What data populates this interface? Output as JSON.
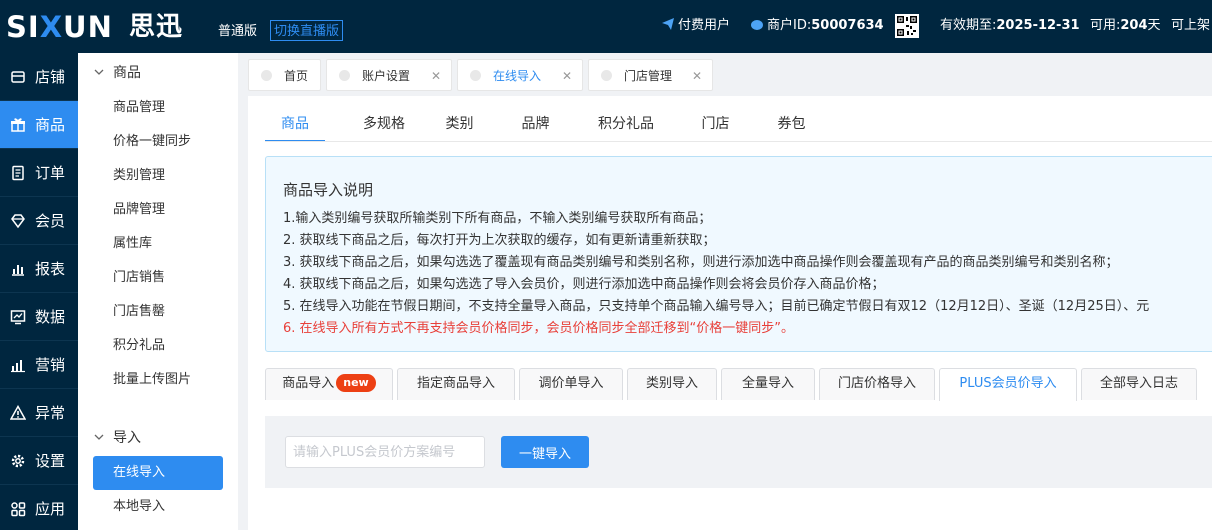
{
  "header": {
    "logo_text_a": "SI",
    "logo_text_x": "X",
    "logo_text_b": "UN",
    "logo_cn": "思迅",
    "edition": "普通版",
    "switch_label": "切换直播版",
    "paid_user": "付费用户",
    "merchant_label": "商户ID:",
    "merchant_id": "50007634",
    "valid_label": "有效期至:",
    "valid_date": "2025-12-31",
    "avail_label": "可用:",
    "avail_days": "204",
    "avail_unit": "天",
    "shelf": "可上架"
  },
  "leftnav": {
    "items": [
      {
        "label": "店铺",
        "icon": "store-icon"
      },
      {
        "label": "商品",
        "icon": "gift-icon"
      },
      {
        "label": "订单",
        "icon": "order-icon"
      },
      {
        "label": "会员",
        "icon": "diamond-icon"
      },
      {
        "label": "报表",
        "icon": "report-icon"
      },
      {
        "label": "数据",
        "icon": "data-icon"
      },
      {
        "label": "营销",
        "icon": "marketing-icon"
      },
      {
        "label": "异常",
        "icon": "warning-icon"
      },
      {
        "label": "设置",
        "icon": "gear-icon"
      },
      {
        "label": "应用",
        "icon": "apps-icon"
      }
    ],
    "active_index": 1
  },
  "submenu": {
    "group1": "商品",
    "items1": [
      "商品管理",
      "价格一键同步",
      "类别管理",
      "品牌管理",
      "属性库",
      "门店销售",
      "门店售罄",
      "积分礼品",
      "批量上传图片"
    ],
    "group2": "导入",
    "items2": [
      "在线导入",
      "本地导入"
    ],
    "active": "在线导入"
  },
  "pagetabs": [
    {
      "label": "首页",
      "closable": false
    },
    {
      "label": "账户设置",
      "closable": true
    },
    {
      "label": "在线导入",
      "closable": true
    },
    {
      "label": "门店管理",
      "closable": true
    }
  ],
  "maintabs": [
    "商品",
    "多规格",
    "类别",
    "品牌",
    "积分礼品",
    "门店",
    "券包"
  ],
  "info": {
    "title": "商品导入说明",
    "lines": [
      "1.输入类别编号获取所输类别下所有商品，不输入类别编号获取所有商品；",
      "2. 获取线下商品之后，每次打开为上次获取的缓存，如有更新请重新获取；",
      "3. 获取线下商品之后，如果勾选选了覆盖现有商品类别编号和类别名称，则进行添加选中商品操作则会覆盖现有产品的商品类别编号和类别名称；",
      "4. 获取线下商品之后，如果勾选选了导入会员价，则进行添加选中商品操作则会将会员价存入商品价格；",
      "5. 在线导入功能在节假日期间，不支持全量导入商品，只支持单个商品输入编号导入；目前已确定节假日有双12（12月12日）、圣诞（12月25日）、元"
    ],
    "warning": "6. 在线导入所有方式不再支持会员价格同步，会员价格同步全部迁移到“价格一键同步”。"
  },
  "subtabs": [
    "商品导入",
    "指定商品导入",
    "调价单导入",
    "类别导入",
    "全量导入",
    "门店价格导入",
    "PLUS会员价导入",
    "全部导入日志"
  ],
  "badge": "new",
  "import": {
    "placeholder": "请输入PLUS会员价方案编号",
    "button": "一键导入"
  },
  "colors": {
    "primary": "#2e8cf0",
    "header_bg": "#00263f",
    "warning_text": "#e8403a",
    "badge": "#ed4014"
  }
}
